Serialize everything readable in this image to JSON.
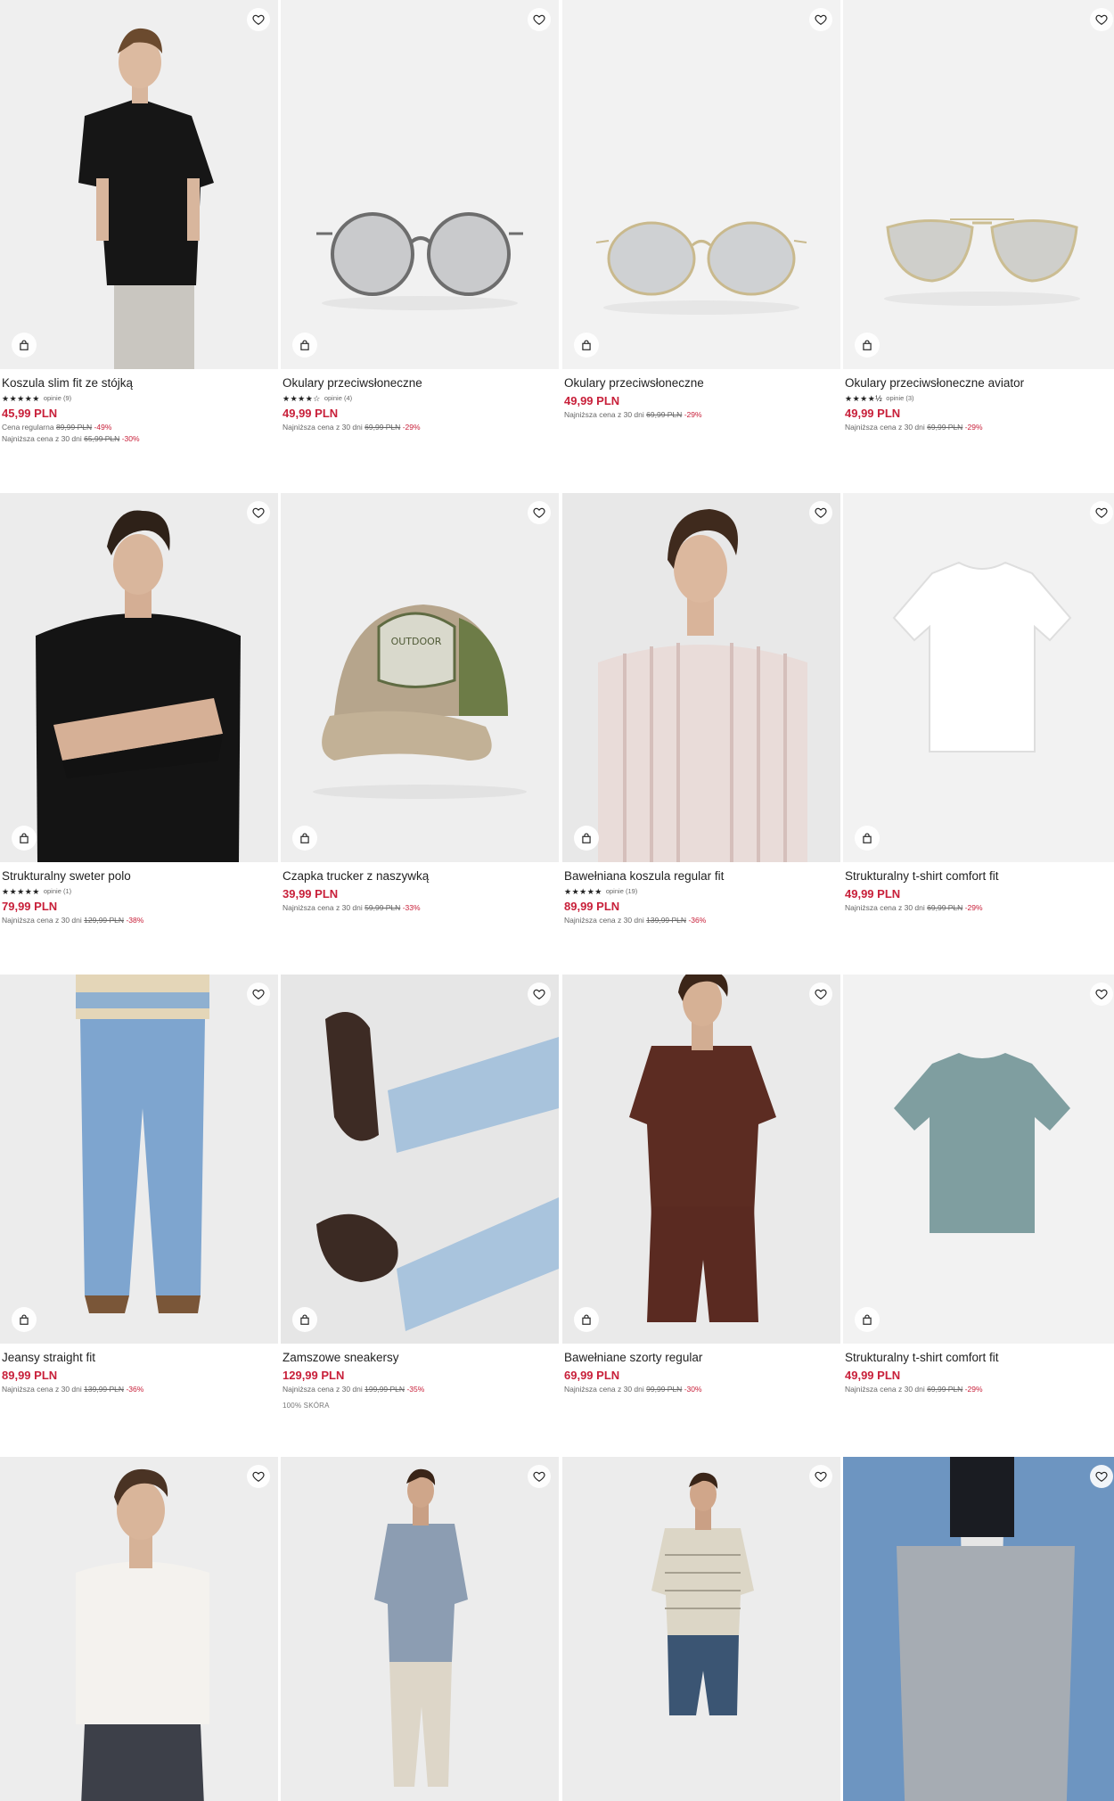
{
  "products": [
    {
      "name": "Koszula slim fit ze stójką",
      "stars": "★★★★★",
      "reviews": "opinie (9)",
      "price": "45,99 PLN",
      "notes": [
        {
          "label": "Cena regularna",
          "old": "89,99 PLN",
          "discount": "-49%"
        },
        {
          "label": "Najniższa cena z 30 dni",
          "old": "65,99 PLN",
          "discount": "-30%"
        }
      ]
    },
    {
      "name": "Okulary przeciwsłoneczne",
      "stars": "★★★★☆",
      "reviews": "opinie (4)",
      "price": "49,99 PLN",
      "notes": [
        {
          "label": "Najniższa cena z 30 dni",
          "old": "69,99 PLN",
          "discount": "-29%"
        }
      ]
    },
    {
      "name": "Okulary przeciwsłoneczne",
      "stars": "",
      "reviews": "",
      "price": "49,99 PLN",
      "notes": [
        {
          "label": "Najniższa cena z 30 dni",
          "old": "69,99 PLN",
          "discount": "-29%"
        }
      ]
    },
    {
      "name": "Okulary przeciwsłoneczne aviator",
      "stars": "★★★★½",
      "reviews": "opinie (3)",
      "price": "49,99 PLN",
      "notes": [
        {
          "label": "Najniższa cena z 30 dni",
          "old": "69,99 PLN",
          "discount": "-29%"
        }
      ]
    },
    {
      "name": "Strukturalny sweter polo",
      "stars": "★★★★★",
      "reviews": "opinie (1)",
      "price": "79,99 PLN",
      "notes": [
        {
          "label": "Najniższa cena z 30 dni",
          "old": "129,99 PLN",
          "discount": "-38%"
        }
      ]
    },
    {
      "name": "Czapka trucker z naszywką",
      "stars": "",
      "reviews": "",
      "price": "39,99 PLN",
      "notes": [
        {
          "label": "Najniższa cena z 30 dni",
          "old": "59,99 PLN",
          "discount": "-33%"
        }
      ]
    },
    {
      "name": "Bawełniana koszula regular fit",
      "stars": "★★★★★",
      "reviews": "opinie (19)",
      "price": "89,99 PLN",
      "notes": [
        {
          "label": "Najniższa cena z 30 dni",
          "old": "139,99 PLN",
          "discount": "-36%"
        }
      ]
    },
    {
      "name": "Strukturalny t-shirt comfort fit",
      "stars": "",
      "reviews": "",
      "price": "49,99 PLN",
      "notes": [
        {
          "label": "Najniższa cena z 30 dni",
          "old": "69,99 PLN",
          "discount": "-29%"
        }
      ]
    },
    {
      "name": "Jeansy straight fit",
      "stars": "",
      "reviews": "",
      "price": "89,99 PLN",
      "notes": [
        {
          "label": "Najniższa cena z 30 dni",
          "old": "139,99 PLN",
          "discount": "-36%"
        }
      ]
    },
    {
      "name": "Zamszowe sneakersy",
      "stars": "",
      "reviews": "",
      "price": "129,99 PLN",
      "notes": [
        {
          "label": "Najniższa cena z 30 dni",
          "old": "199,99 PLN",
          "discount": "-35%"
        }
      ],
      "tag": "100% SKÓRA"
    },
    {
      "name": "Bawełniane szorty regular",
      "stars": "",
      "reviews": "",
      "price": "69,99 PLN",
      "notes": [
        {
          "label": "Najniższa cena z 30 dni",
          "old": "99,99 PLN",
          "discount": "-30%"
        }
      ]
    },
    {
      "name": "Strukturalny t-shirt comfort fit",
      "stars": "",
      "reviews": "",
      "price": "49,99 PLN",
      "notes": [
        {
          "label": "Najniższa cena z 30 dni",
          "old": "69,99 PLN",
          "discount": "-29%"
        }
      ]
    },
    {
      "name": "",
      "stars": "",
      "reviews": "",
      "price": "",
      "notes": []
    },
    {
      "name": "",
      "stars": "",
      "reviews": "",
      "price": "",
      "notes": []
    },
    {
      "name": "",
      "stars": "",
      "reviews": "",
      "price": "",
      "notes": []
    },
    {
      "name": "",
      "stars": "",
      "reviews": "",
      "price": "",
      "notes": []
    }
  ],
  "icons": {
    "favorite": "heart-icon",
    "bag": "shopping-bag-icon"
  },
  "colors": {
    "price": "#c8203a",
    "discount": "#c8203a",
    "image_bg": "#f0f0f0"
  }
}
